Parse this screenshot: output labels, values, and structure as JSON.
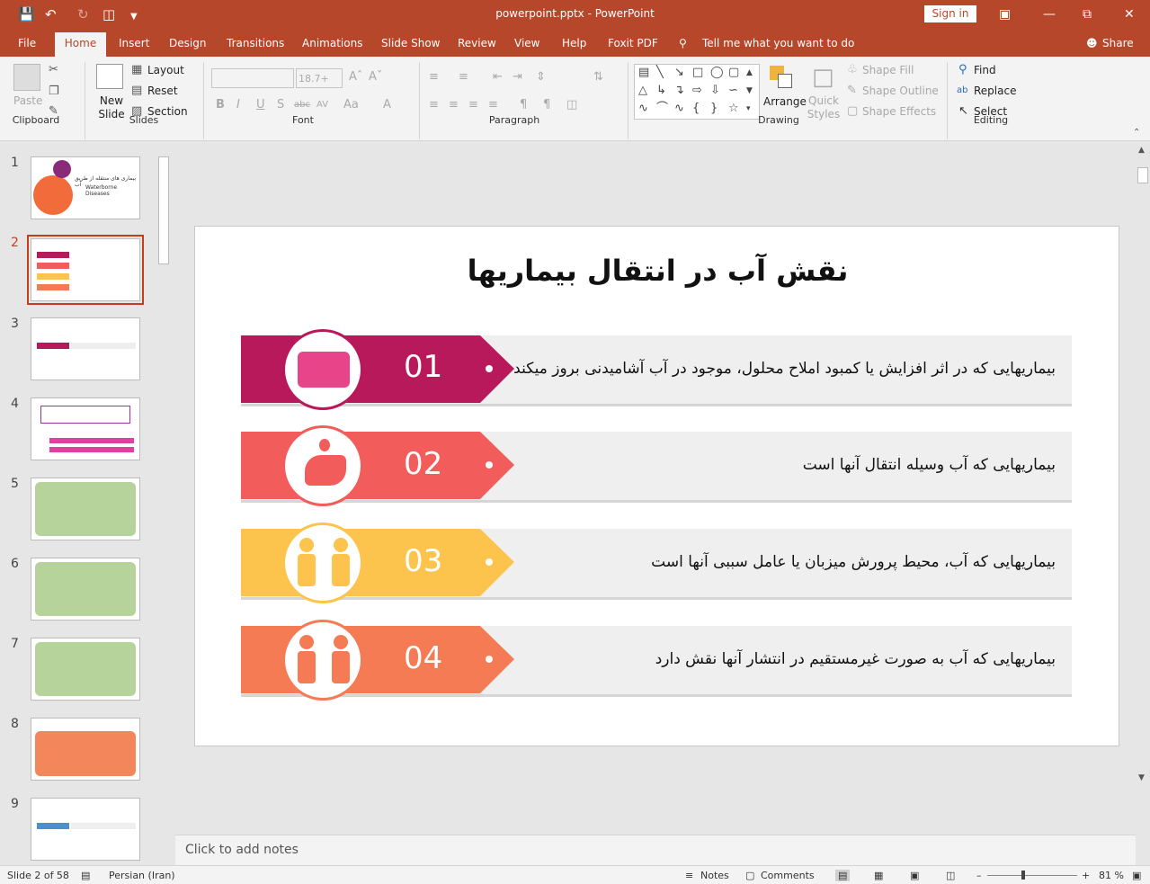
{
  "titlebar": {
    "doc_title": "powerpoint.pptx  -  PowerPoint",
    "signin": "Sign in"
  },
  "tabs": [
    "File",
    "Home",
    "Insert",
    "Design",
    "Transitions",
    "Animations",
    "Slide Show",
    "Review",
    "View",
    "Help",
    "Foxit PDF"
  ],
  "tell_me": "Tell me what you want to do",
  "share": "Share",
  "ribbon": {
    "clipboard": {
      "label": "Clipboard",
      "paste": "Paste"
    },
    "slides": {
      "label": "Slides",
      "new_slide": "New Slide",
      "layout": "Layout",
      "reset": "Reset",
      "section": "Section"
    },
    "font": {
      "label": "Font",
      "size": "18.7+"
    },
    "paragraph": {
      "label": "Paragraph"
    },
    "drawing": {
      "label": "Drawing",
      "arrange": "Arrange",
      "quick_styles": "Quick Styles",
      "shape_fill": "Shape Fill",
      "shape_outline": "Shape Outline",
      "shape_effects": "Shape Effects"
    },
    "editing": {
      "label": "Editing",
      "find": "Find",
      "replace": "Replace",
      "select": "Select"
    }
  },
  "thumbnails": [
    {
      "num": "1",
      "title": "بیماری های منتقله از طریق آب",
      "subtitle": "Waterborne Diseases"
    },
    {
      "num": "2"
    },
    {
      "num": "3"
    },
    {
      "num": "4"
    },
    {
      "num": "5"
    },
    {
      "num": "6"
    },
    {
      "num": "7"
    },
    {
      "num": "8"
    },
    {
      "num": "9"
    }
  ],
  "slide": {
    "title": "نقش آب در انتقال بیماریها",
    "rows": [
      {
        "num": "01",
        "text": "بیماریهایی که در اثر افزایش یا کمبود املاح محلول، موجود در آب آشامیدنی بروز میکند",
        "color": "#b8195a",
        "icon": "card-icon"
      },
      {
        "num": "02",
        "text": "بیماریهایی که آب وسیله انتقال آنها است",
        "color": "#f25c5a",
        "icon": "hand-drop-icon"
      },
      {
        "num": "03",
        "text": "بیماریهایی که آب، محیط پرورش میزبان یا عامل سببی آنها است",
        "color": "#fcc44d",
        "icon": "people-icon"
      },
      {
        "num": "04",
        "text": "بیماریهایی که آب به صورت غیرمستقیم در انتشار آنها نقش دارد",
        "color": "#f47b54",
        "icon": "people-icon"
      }
    ]
  },
  "notes_placeholder": "Click to add notes",
  "status": {
    "slide": "Slide 2 of 58",
    "language": "Persian (Iran)",
    "notes": "Notes",
    "comments": "Comments",
    "zoom": "81 %"
  }
}
